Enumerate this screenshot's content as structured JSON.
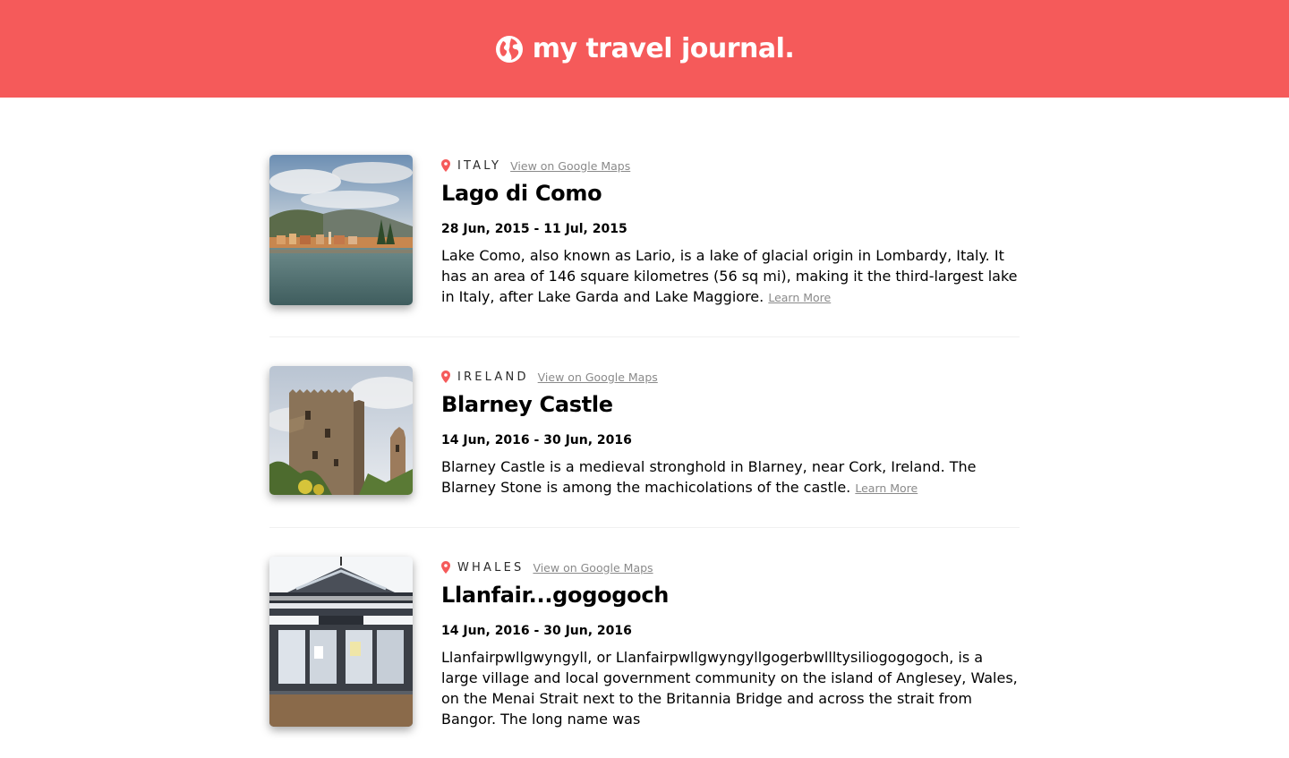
{
  "header": {
    "title": "my travel journal.",
    "icon": "globe-icon",
    "background": "#f55a5a"
  },
  "entries": [
    {
      "country": "ITALY",
      "maps_link": "View on Google Maps",
      "title": "Lago di Como",
      "dates": "28 Jun, 2015 - 11 Jul, 2015",
      "description": "Lake Como, also known as Lario, is a lake of glacial origin in Lombardy, Italy. It has an area of 146 square kilometres (56 sq mi), making it the third-largest lake in Italy, after Lake Garda and Lake Maggiore.",
      "learn_more": "Learn More",
      "image": "lake-como-photo"
    },
    {
      "country": "IRELAND",
      "maps_link": "View on Google Maps",
      "title": "Blarney Castle",
      "dates": "14 Jun, 2016 - 30 Jun, 2016",
      "description": "Blarney Castle is a medieval stronghold in Blarney, near Cork, Ireland. The Blarney Stone is among the machicolations of the castle.",
      "learn_more": "Learn More",
      "image": "blarney-castle-photo"
    },
    {
      "country": "WHALES",
      "maps_link": "View on Google Maps",
      "title": "Llanfair...gogogoch",
      "dates": "14 Jun, 2016 - 30 Jun, 2016",
      "description": "Llanfairpwllgwyngyll, or Llanfairpwllgwyngyllgogerbwllltysiliogogogoch, is a large village and local government community on the island of Anglesey, Wales, on the Menai Strait next to the Britannia Bridge and across the strait from Bangor. The long name was",
      "learn_more": "",
      "image": "llanfair-station-photo"
    }
  ]
}
